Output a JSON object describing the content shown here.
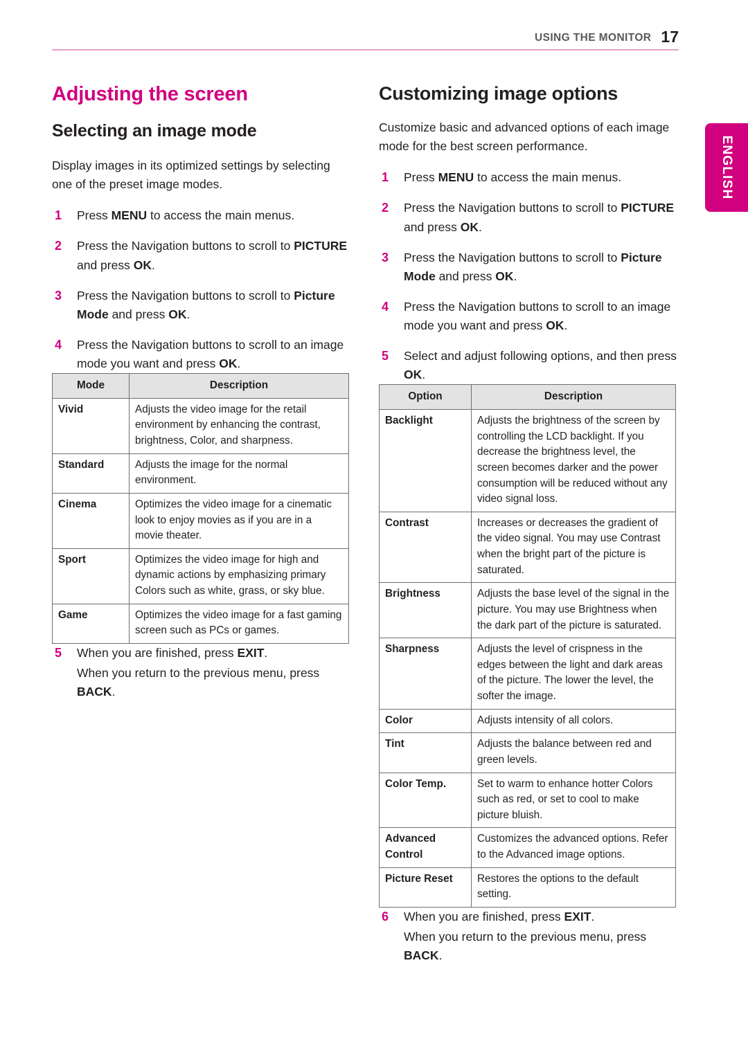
{
  "header": {
    "title": "USING THE MONITOR",
    "page_number": "17",
    "rule_color": "#e7a0c8"
  },
  "language_tab": {
    "label": "ENGLISH",
    "color": "#d1007e"
  },
  "colors": {
    "magenta": "#d1007e",
    "body_text": "#231f20",
    "table_header_bg": "#e3e3e3",
    "table_border": "#6d6e71"
  },
  "left_column": {
    "heading": "Adjusting the screen",
    "subheading": "Selecting an image mode",
    "intro": "Display images in its optimized settings by selecting one of the preset image modes.",
    "steps": [
      {
        "num": "1",
        "pre": "Press ",
        "bold1": "MENU",
        "mid": " to access the main menus.",
        "bold2": "",
        "post": ""
      },
      {
        "num": "2",
        "pre": "Press the Navigation buttons to scroll to ",
        "bold1": "PICTURE",
        "mid": " and press ",
        "bold2": "OK",
        "post": "."
      },
      {
        "num": "3",
        "pre": "Press the Navigation buttons to scroll to ",
        "bold1": "Picture Mode",
        "mid": " and press ",
        "bold2": "OK",
        "post": "."
      },
      {
        "num": "4",
        "pre": "Press the Navigation buttons to scroll to an image mode you want and press ",
        "bold1": "OK",
        "mid": ".",
        "bold2": "",
        "post": ""
      }
    ],
    "table": {
      "columns": [
        "Mode",
        "Description"
      ],
      "rows": [
        {
          "key": "Vivid",
          "desc": "Adjusts the video image for the retail environment by enhancing the contrast, brightness, Color, and sharpness."
        },
        {
          "key": "Standard",
          "desc": "Adjusts the image for the normal environment."
        },
        {
          "key": "Cinema",
          "desc": "Optimizes the video image for a cinematic look to enjoy movies as if you are in a movie theater."
        },
        {
          "key": "Sport",
          "desc": "Optimizes the video image for high and dynamic actions by emphasizing primary Colors such as white, grass, or sky blue."
        },
        {
          "key": "Game",
          "desc": "Optimizes the video image for a fast gaming screen such as PCs or games."
        }
      ]
    },
    "final_step": {
      "num": "5",
      "pre": "When you are finished, press ",
      "bold1": "EXIT",
      "mid": ".",
      "sub_pre": "When you return to the previous menu, press ",
      "sub_bold": "BACK",
      "sub_post": "."
    }
  },
  "right_column": {
    "heading": "Customizing image options",
    "intro": "Customize basic and advanced options of each image mode for the best screen performance.",
    "steps": [
      {
        "num": "1",
        "pre": "Press ",
        "bold1": "MENU",
        "mid": " to access the main menus.",
        "bold2": "",
        "post": ""
      },
      {
        "num": "2",
        "pre": "Press the Navigation buttons to scroll to ",
        "bold1": "PICTURE",
        "mid": " and press ",
        "bold2": "OK",
        "post": "."
      },
      {
        "num": "3",
        "pre": "Press the Navigation buttons to scroll to ",
        "bold1": "Picture Mode",
        "mid": " and press ",
        "bold2": "OK",
        "post": "."
      },
      {
        "num": "4",
        "pre": "Press the Navigation buttons to scroll to an image mode you want and press ",
        "bold1": "OK",
        "mid": ".",
        "bold2": "",
        "post": ""
      },
      {
        "num": "5",
        "pre": "Select and adjust following options, and then press ",
        "bold1": "OK",
        "mid": ".",
        "bold2": "",
        "post": ""
      }
    ],
    "table": {
      "columns": [
        "Option",
        "Description"
      ],
      "rows": [
        {
          "key": "Backlight",
          "desc": "Adjusts the brightness of the screen by controlling the LCD backlight. If you decrease the brightness level, the screen becomes darker and the power consumption will be reduced without any video signal loss."
        },
        {
          "key": "Contrast",
          "desc": "Increases or decreases the gradient of the video signal. You may use Contrast when the bright part of the picture is saturated."
        },
        {
          "key": "Brightness",
          "desc": "Adjusts the base level of the signal in the picture. You may use Brightness when the dark part of the picture is saturated."
        },
        {
          "key": "Sharpness",
          "desc": "Adjusts the level of crispness in the edges between the light and dark areas of the picture. The lower the level, the softer the image."
        },
        {
          "key": "Color",
          "desc": "Adjusts intensity of all colors."
        },
        {
          "key": "Tint",
          "desc": "Adjusts the balance between red and green levels."
        },
        {
          "key": "Color Temp.",
          "desc": "Set to warm to enhance hotter Colors such as red, or set to cool to make picture bluish."
        },
        {
          "key": "Advanced Control",
          "desc": "Customizes the advanced options. Refer to the Advanced image options."
        },
        {
          "key": "Picture Reset",
          "desc": "Restores the options to the default setting."
        }
      ]
    },
    "final_step": {
      "num": "6",
      "pre": "When you are finished, press ",
      "bold1": "EXIT",
      "mid": ".",
      "sub_pre": "When you return to the previous menu, press ",
      "sub_bold": "BACK",
      "sub_post": "."
    }
  }
}
